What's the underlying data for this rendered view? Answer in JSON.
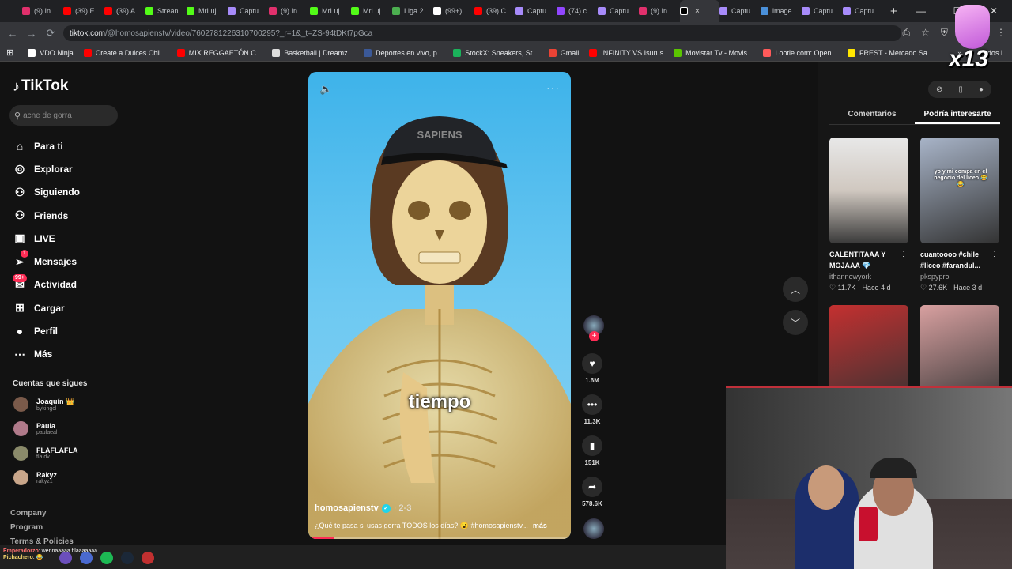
{
  "browser": {
    "tabs": [
      {
        "label": "(9) In",
        "color": "#e1306c"
      },
      {
        "label": "(39) E",
        "color": "#ff0000"
      },
      {
        "label": "(39) A",
        "color": "#ff0000"
      },
      {
        "label": "Strean",
        "color": "#53fc18"
      },
      {
        "label": "MrLuj",
        "color": "#53fc18"
      },
      {
        "label": "Captu",
        "color": "#a78bfa"
      },
      {
        "label": "(9) In",
        "color": "#e1306c"
      },
      {
        "label": "MrLuj",
        "color": "#53fc18"
      },
      {
        "label": "MrLuj",
        "color": "#53fc18"
      },
      {
        "label": "Liga 2",
        "color": "#4caf50"
      },
      {
        "label": "(99+)",
        "color": "#ffffff"
      },
      {
        "label": "(39) C",
        "color": "#ff0000"
      },
      {
        "label": "Captu",
        "color": "#a78bfa"
      },
      {
        "label": "(74) c",
        "color": "#9146ff"
      },
      {
        "label": "Captu",
        "color": "#a78bfa"
      },
      {
        "label": "(9) In",
        "color": "#e1306c"
      }
    ],
    "active_tab_x": "×",
    "tabs_after": [
      {
        "label": "Captu",
        "color": "#a78bfa"
      },
      {
        "label": "image",
        "color": "#4a90d9"
      },
      {
        "label": "Captu",
        "color": "#a78bfa"
      },
      {
        "label": "Captu",
        "color": "#a78bfa"
      }
    ],
    "new_tab": "+",
    "window_controls": [
      "—",
      "☐",
      "✕"
    ],
    "nav_buttons": [
      "←",
      "→",
      "⟳"
    ],
    "url_domain": "tiktok.com",
    "url_path": "/@homosapienstv/video/7602781226310700295?_r=1&_t=ZS-94tDKt7pGca",
    "addr_icons": [
      "⎙",
      "☆",
      "⛨",
      "⧉",
      "◉",
      "⋮"
    ],
    "bookmarks": [
      {
        "label": "VDO.Ninja",
        "color": "#ffffff"
      },
      {
        "label": "Create a Dulces Chil...",
        "color": "#ff0000"
      },
      {
        "label": "MIX REGGAETÓN C...",
        "color": "#ff0000"
      },
      {
        "label": "Basketball | Dreamz...",
        "color": "#dddddd"
      },
      {
        "label": "Deportes en vivo, p...",
        "color": "#3b5998"
      },
      {
        "label": "StockX: Sneakers, St...",
        "color": "#1bb35b"
      },
      {
        "label": "Gmail",
        "color": "#ea4335"
      },
      {
        "label": "INFINITY VS Isurus",
        "color": "#ff0000"
      },
      {
        "label": "Movistar Tv - Movis...",
        "color": "#5bc500"
      },
      {
        "label": "Lootie.com: Open...",
        "color": "#ff5a5a"
      },
      {
        "label": "FREST - Mercado Sa...",
        "color": "#ffe600"
      }
    ],
    "bookmarks_more": "»",
    "bookmarks_folder": "Todos los marcadores"
  },
  "sidebar": {
    "logo": "TikTok",
    "search_placeholder": "acne de gorra",
    "items": [
      {
        "label": "Para ti",
        "icon": "⌂"
      },
      {
        "label": "Explorar",
        "icon": "◎"
      },
      {
        "label": "Siguiendo",
        "icon": "⚇"
      },
      {
        "label": "Friends",
        "icon": "⚇"
      },
      {
        "label": "LIVE",
        "icon": "▣"
      },
      {
        "label": "Mensajes",
        "icon": "➢"
      },
      {
        "label": "Actividad",
        "icon": "✉"
      },
      {
        "label": "Cargar",
        "icon": "⊞"
      },
      {
        "label": "Perfil",
        "icon": "●"
      },
      {
        "label": "Más",
        "icon": "⋯"
      }
    ],
    "messages_badge": "1",
    "activity_badge": "99+",
    "following_title": "Cuentas que sigues",
    "following": [
      {
        "name": "Joaquín 👑",
        "handle": "bykingcl",
        "color": "#7a5a4a"
      },
      {
        "name": "Paula",
        "handle": "paulaeal_",
        "color": "#b07a8a"
      },
      {
        "name": "FLAFLAFLA",
        "handle": "fla.dv",
        "color": "#8a8a6a"
      },
      {
        "name": "Rakyz",
        "handle": "rakyz1",
        "color": "#c9a68a"
      }
    ],
    "footer": [
      "Company",
      "Program",
      "Terms & Policies"
    ]
  },
  "video": {
    "caption_word": "tiempo",
    "cap_text": "SAPIENS",
    "author": "homosapienstv",
    "date": "· 2-3",
    "description": "¿Qué te pasa si usas gorra TODOS los días? 😮 #homosapienstv...",
    "more": "más",
    "progress": 0.1
  },
  "actions": {
    "likes": "1.6M",
    "comments": "11.3K",
    "saves": "151K",
    "shares": "578.6K"
  },
  "right_panel": {
    "tabs": [
      "Comentarios",
      "Podría interesarte"
    ],
    "cards": [
      {
        "title": "CALENTITAAA Y MOJAAA 💎",
        "author": "ithannewyork",
        "likes": "11.7K",
        "age": "Hace 4 d",
        "thumb_color": "#d8d8d8",
        "overlay": ""
      },
      {
        "title": "cuantoooo #chile #liceo #farandul...",
        "author": "pkspypro",
        "likes": "27.6K",
        "age": "Hace 3 d",
        "thumb_color": "#a8b4c8",
        "overlay": "yo y mi compa en el negocio del liceo 😂😂"
      },
      {
        "title": "",
        "author": "",
        "likes": "",
        "age": "",
        "thumb_color": "#c43030",
        "overlay": ""
      },
      {
        "title": "",
        "author": "",
        "likes": "",
        "age": "",
        "thumb_color": "#d8a0a0",
        "overlay": ""
      }
    ]
  },
  "stream_overlay": {
    "multiplier": "x13",
    "chat": [
      {
        "user": "Emperadorzo",
        "msg": ": wennaaaaa fllaaaaaaa"
      },
      {
        "user": "Pichachero",
        "msg": ": 😂"
      }
    ]
  }
}
